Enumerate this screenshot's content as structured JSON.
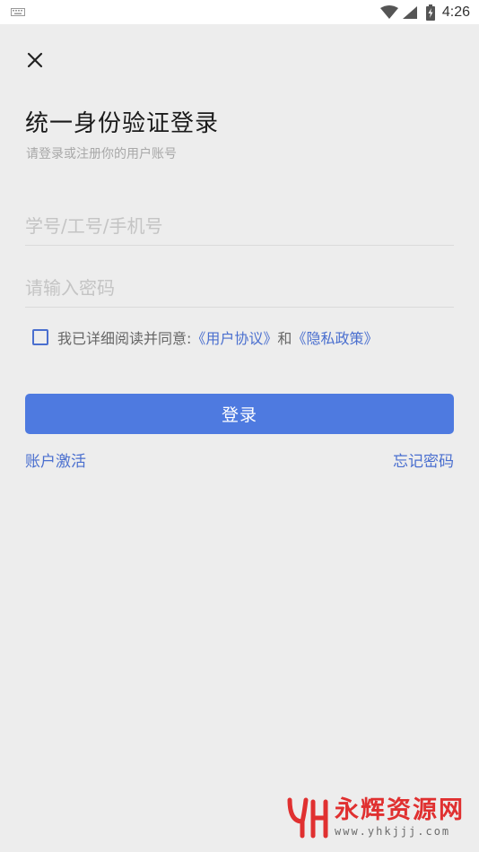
{
  "status_bar": {
    "time": "4:26",
    "icons": [
      "keyboard-icon",
      "wifi-icon",
      "signal-icon",
      "battery-icon"
    ]
  },
  "header": {
    "close_icon": "close-icon",
    "title": "统一身份验证登录",
    "subtitle": "请登录或注册你的用户账号"
  },
  "form": {
    "account_placeholder": "学号/工号/手机号",
    "account_value": "",
    "password_placeholder": "请输入密码",
    "password_value": "",
    "agreement": {
      "checked": false,
      "prefix": "我已详细阅读并同意:",
      "user_agreement": "《用户协议》",
      "and": "和",
      "privacy_policy": "《隐私政策》"
    },
    "login_label": "登录"
  },
  "links": {
    "activate": "账户激活",
    "forgot_password": "忘记密码"
  },
  "watermark": {
    "title": "永辉资源网",
    "url": "www.yhkjjj.com"
  },
  "colors": {
    "accent": "#4e7ae0",
    "link": "#4a6fcf",
    "background": "#ededed",
    "watermark": "#e03030"
  }
}
